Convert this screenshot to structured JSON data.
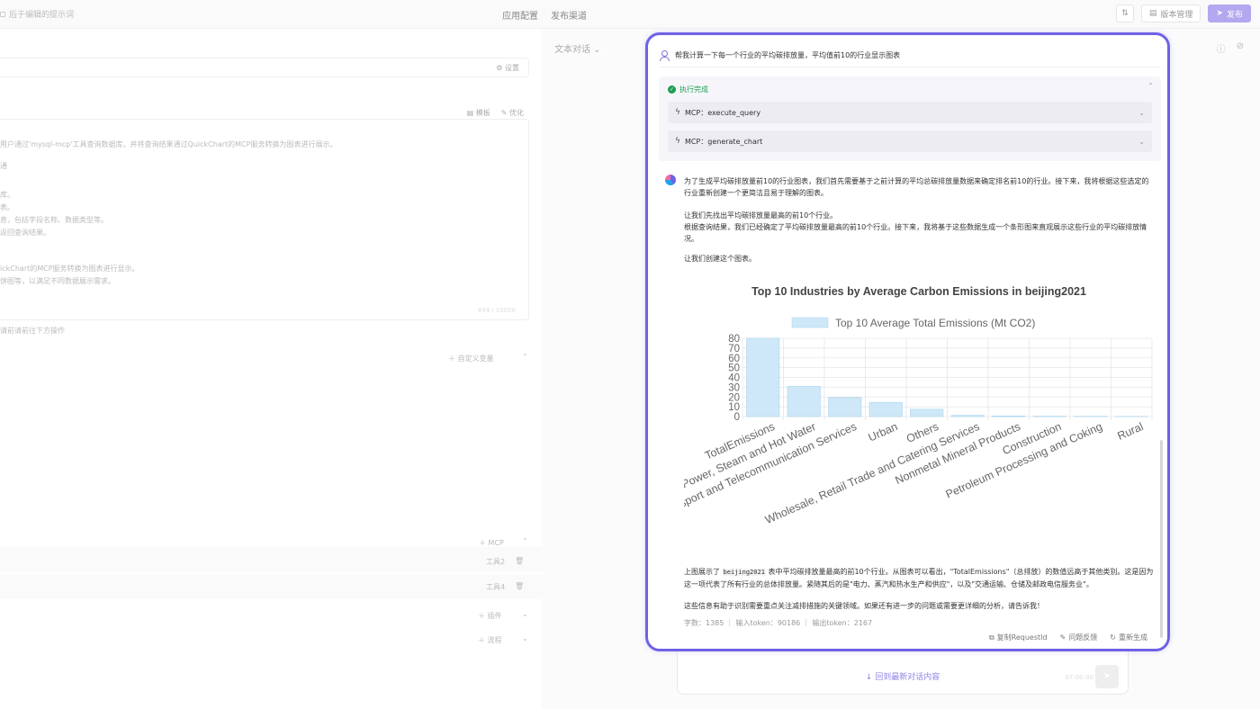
{
  "topbar": {
    "breadcrumb": "后于编辑的提示词",
    "links": [
      "应用配置",
      "发布渠道"
    ],
    "version_btn": "版本管理",
    "publish_btn": "发布"
  },
  "editor": {
    "settings_label": "设置",
    "template_label": "模板",
    "optimize_label": "优化",
    "prompt_lines": [
      "用户通过'mysql-mcp'工具查询数据库，并将查询结果通过QuickChart的MCP服务转换为图表进行展示。",
      "通",
      "库。",
      "表。",
      "息，包括字段名称、数据类型等。",
      "返回查询结果。",
      "ickChart的MCP服务转换为图表进行显示。",
      "饼图等，以满足不同数据展示需求。"
    ],
    "char_count": "494 / 10000",
    "hint": "请前请前往下方操作",
    "custom_var": "自定义变量",
    "mcp_label": "MCP",
    "tool2": "工具2",
    "tool4": "工具4",
    "plugin_label": "插件",
    "flow_label": "流程"
  },
  "preview": {
    "title": "文本对话"
  },
  "chat": {
    "user_message": "帮我计算一下每一个行业的平均碳排放量，平均值前10的行业显示图表",
    "exec_status": "执行完成",
    "mcp_calls": [
      "MCP：execute_query",
      "MCP：generate_chart"
    ],
    "answer_p1": "为了生成平均碳排放量前10的行业图表，我们首先需要基于之前计算的平均总碳排放量数据来确定排名前10的行业。接下来，我将根据这些选定的行业重新创建一个更简洁且易于理解的图表。",
    "answer_p2": "让我们先找出平均碳排放量最高的前10个行业。",
    "answer_p3": "根据查询结果，我们已经确定了平均碳排放量最高的前10个行业。接下来，我将基于这些数据生成一个条形图来直观展示这些行业的平均碳排放情况。",
    "answer_p4": "让我们创建这个图表。",
    "answer_p5_pre": "上图展示了",
    "answer_p5_code": "beijing2021",
    "answer_p5_post": "表中平均碳排放量最高的前10个行业。从图表可以看出，\"TotalEmissions\"（总排放）的数值远高于其他类别。这是因为这一项代表了所有行业的总体排放量。紧随其后的是\"电力、蒸汽和热水生产和供应\"，以及\"交通运输、仓储及邮政电信服务业\"。",
    "answer_p6": "这些信息有助于识别需要重点关注减排措施的关键领域。如果还有进一步的问题或需要更详细的分析，请告诉我！",
    "stats": "字数：1385 ｜ 输入token：90186 ｜ 输出token：2167",
    "actions": [
      "复制RequestId",
      "问题反馈",
      "重新生成"
    ]
  },
  "input": {
    "back_to_latest": "回到最新对话内容",
    "timestamp": "07:00:00"
  },
  "chart_data": {
    "type": "bar",
    "title": "Top 10 Industries by Average Carbon Emissions in beijing2021",
    "legend": "Top 10 Average Total Emissions (Mt CO2)",
    "legend_position": "top",
    "categories": [
      "TotalEmissions",
      "Power, Steam and Hot Water",
      "Transport and Telecommunication Services",
      "Urban",
      "Others",
      "Wholesale, Retail Trade and Catering Services",
      "Nonmetal Mineral Products",
      "Construction",
      "Petroleum Processing and Coking",
      "Rural"
    ],
    "values": [
      80,
      31,
      19.5,
      14.5,
      7.5,
      1.2,
      0.6,
      0.4,
      0.3,
      0.2
    ],
    "ylim": [
      0,
      80
    ],
    "yticks": [
      0,
      10,
      20,
      30,
      40,
      50,
      60,
      70,
      80
    ],
    "grid": true,
    "bar_color": "#cfe8f7",
    "bar_stroke": "#a8d4ef"
  },
  "colors": {
    "accent": "#6e62e5",
    "success": "#1f9d55"
  }
}
